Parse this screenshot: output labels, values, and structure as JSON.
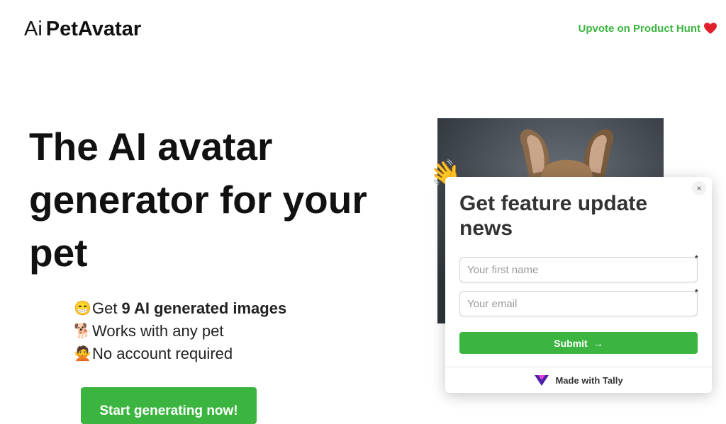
{
  "header": {
    "logo_prefix": "Ai",
    "logo_name": "PetAvatar",
    "producthunt_link": "Upvote on Product Hunt"
  },
  "hero": {
    "title": "The AI avatar generator for your pet",
    "features": [
      {
        "emoji": "😁",
        "prefix": "Get",
        "bold": "9 AI generated images"
      },
      {
        "emoji": "🐕",
        "text": "Works with any pet"
      },
      {
        "emoji": "🙅",
        "text": "No account required"
      }
    ],
    "cta_label": "Start generating now!"
  },
  "popup": {
    "wave_emoji": "👋",
    "close_symbol": "×",
    "title": "Get feature update news",
    "first_name_placeholder": "Your first name",
    "email_placeholder": "Your email",
    "required_mark": "*",
    "submit_label": "Submit",
    "submit_arrow": "→",
    "footer_label": "Made with Tally"
  },
  "colors": {
    "accent_green": "#3bb540",
    "heart_red": "#e0202c",
    "tally_purple": "#4b1fa8"
  }
}
